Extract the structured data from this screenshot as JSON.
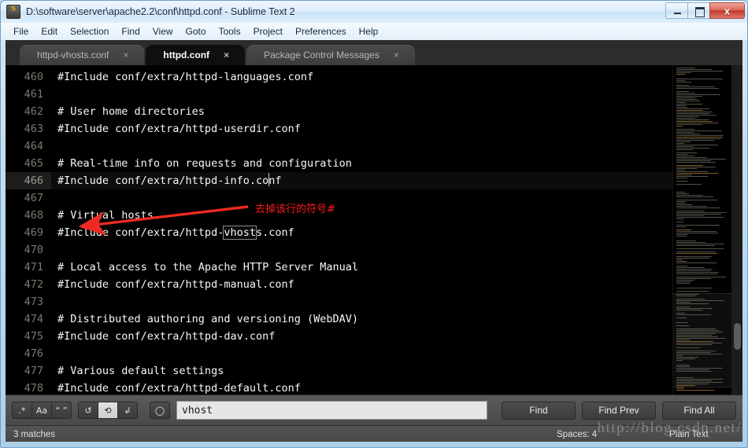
{
  "window": {
    "title": "D:\\software\\server\\apache2.2\\conf\\httpd.conf - Sublime Text 2",
    "icon": "sublime-icon",
    "minimize": "–",
    "maximize": "□",
    "close": "x"
  },
  "menubar": {
    "items": [
      "File",
      "Edit",
      "Selection",
      "Find",
      "View",
      "Goto",
      "Tools",
      "Project",
      "Preferences",
      "Help"
    ]
  },
  "tabs": [
    {
      "label": "httpd-vhosts.conf",
      "close": "×",
      "active": false
    },
    {
      "label": "httpd.conf",
      "close": "×",
      "active": true
    },
    {
      "label": "Package Control Messages",
      "close": "×",
      "active": false
    }
  ],
  "editor": {
    "first_line": 460,
    "lines": [
      {
        "n": "460",
        "text": "#Include conf/extra/httpd-languages.conf"
      },
      {
        "n": "461",
        "text": ""
      },
      {
        "n": "462",
        "text": "# User home directories"
      },
      {
        "n": "463",
        "text": "#Include conf/extra/httpd-userdir.conf"
      },
      {
        "n": "464",
        "text": ""
      },
      {
        "n": "465",
        "text": "# Real-time info on requests and configuration"
      },
      {
        "n": "466",
        "text": "#Include conf/extra/httpd-info.conf",
        "current": true
      },
      {
        "n": "467",
        "text": ""
      },
      {
        "n": "468",
        "text": "# Virtual hosts"
      },
      {
        "n": "469",
        "text": "#Include conf/extra/httpd-vhosts.conf",
        "match": {
          "pre": "#Include conf/extra/httpd-",
          "hit": "vhost",
          "post": "s.conf"
        }
      },
      {
        "n": "470",
        "text": ""
      },
      {
        "n": "471",
        "text": "# Local access to the Apache HTTP Server Manual"
      },
      {
        "n": "472",
        "text": "#Include conf/extra/httpd-manual.conf"
      },
      {
        "n": "473",
        "text": ""
      },
      {
        "n": "474",
        "text": "# Distributed authoring and versioning (WebDAV)"
      },
      {
        "n": "475",
        "text": "#Include conf/extra/httpd-dav.conf"
      },
      {
        "n": "476",
        "text": ""
      },
      {
        "n": "477",
        "text": "# Various default settings"
      },
      {
        "n": "478",
        "text": "#Include conf/extra/httpd-default.conf"
      }
    ]
  },
  "annotation": {
    "text": "去掉该行的符号#",
    "color": "#ff1a1a",
    "arrow": "red-arrow"
  },
  "findbar": {
    "toggles": [
      {
        "name": "regex-toggle",
        "label": ".*",
        "on": false
      },
      {
        "name": "case-toggle",
        "label": "Aa",
        "on": false
      },
      {
        "name": "whole-word-toggle",
        "label": "“ ”",
        "on": false
      },
      {
        "name": "in-selection-toggle",
        "label": "↺",
        "on": false
      },
      {
        "name": "wrap-toggle",
        "label": "⟲",
        "on": true
      },
      {
        "name": "highlight-toggle",
        "label": "↲",
        "on": false
      },
      {
        "name": "preserve-case-toggle",
        "label": "◯",
        "on": false
      }
    ],
    "search_value": "vhost",
    "search_placeholder": "Find",
    "buttons": [
      "Find",
      "Find Prev",
      "Find All"
    ]
  },
  "statusbar": {
    "matches": "3 matches",
    "indent": "Spaces: 4",
    "syntax": "Plain Text"
  },
  "watermark": "http://blog.csdn.net/",
  "colors": {
    "accent": "#ff1a1a",
    "editor_bg": "#000000",
    "tab_active_bg": "#0f0f0f",
    "chrome": "#4a4a4a"
  }
}
